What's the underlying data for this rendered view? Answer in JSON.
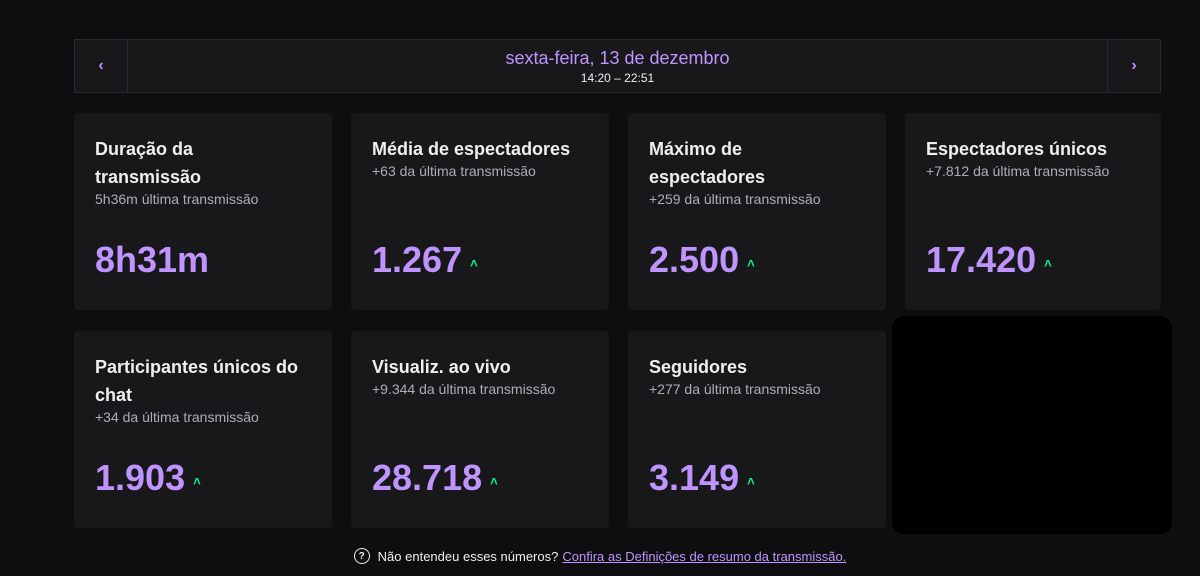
{
  "header": {
    "prev_icon": "chevron-left-icon",
    "next_icon": "chevron-right-icon",
    "prev_glyph": "‹",
    "next_glyph": "›",
    "date": "sexta-feira, 13 de dezembro",
    "time_range": "14:20 – 22:51"
  },
  "stats": [
    {
      "title": "Duração da transmissão",
      "sub": "5h36m última transmissão",
      "value": "8h31m",
      "up": false
    },
    {
      "title": "Média de espectadores",
      "sub": "+63 da última transmissão",
      "value": "1.267",
      "up": true
    },
    {
      "title": "Máximo de espectadores",
      "sub": "+259 da última transmissão",
      "value": "2.500",
      "up": true
    },
    {
      "title": "Espectadores únicos",
      "sub": "+7.812 da última transmissão",
      "value": "17.420",
      "up": true
    },
    {
      "title": "Participantes únicos do chat",
      "sub": "+34 da última transmissão",
      "value": "1.903",
      "up": true
    },
    {
      "title": "Visualiz. ao vivo",
      "sub": "+9.344 da última transmissão",
      "value": "28.718",
      "up": true
    },
    {
      "title": "Seguidores",
      "sub": "+277 da última transmissão",
      "value": "3.149",
      "up": true
    }
  ],
  "up_glyph": "˄",
  "footer": {
    "help_icon": "question-circle-icon",
    "help_glyph": "?",
    "text": "Não entendeu esses números?",
    "link": "Confira as Definições de resumo da transmissão."
  },
  "colors": {
    "accent": "#bf94ff",
    "increase": "#00f593",
    "card_bg": "#18181b",
    "page_bg": "#0e0e10"
  }
}
